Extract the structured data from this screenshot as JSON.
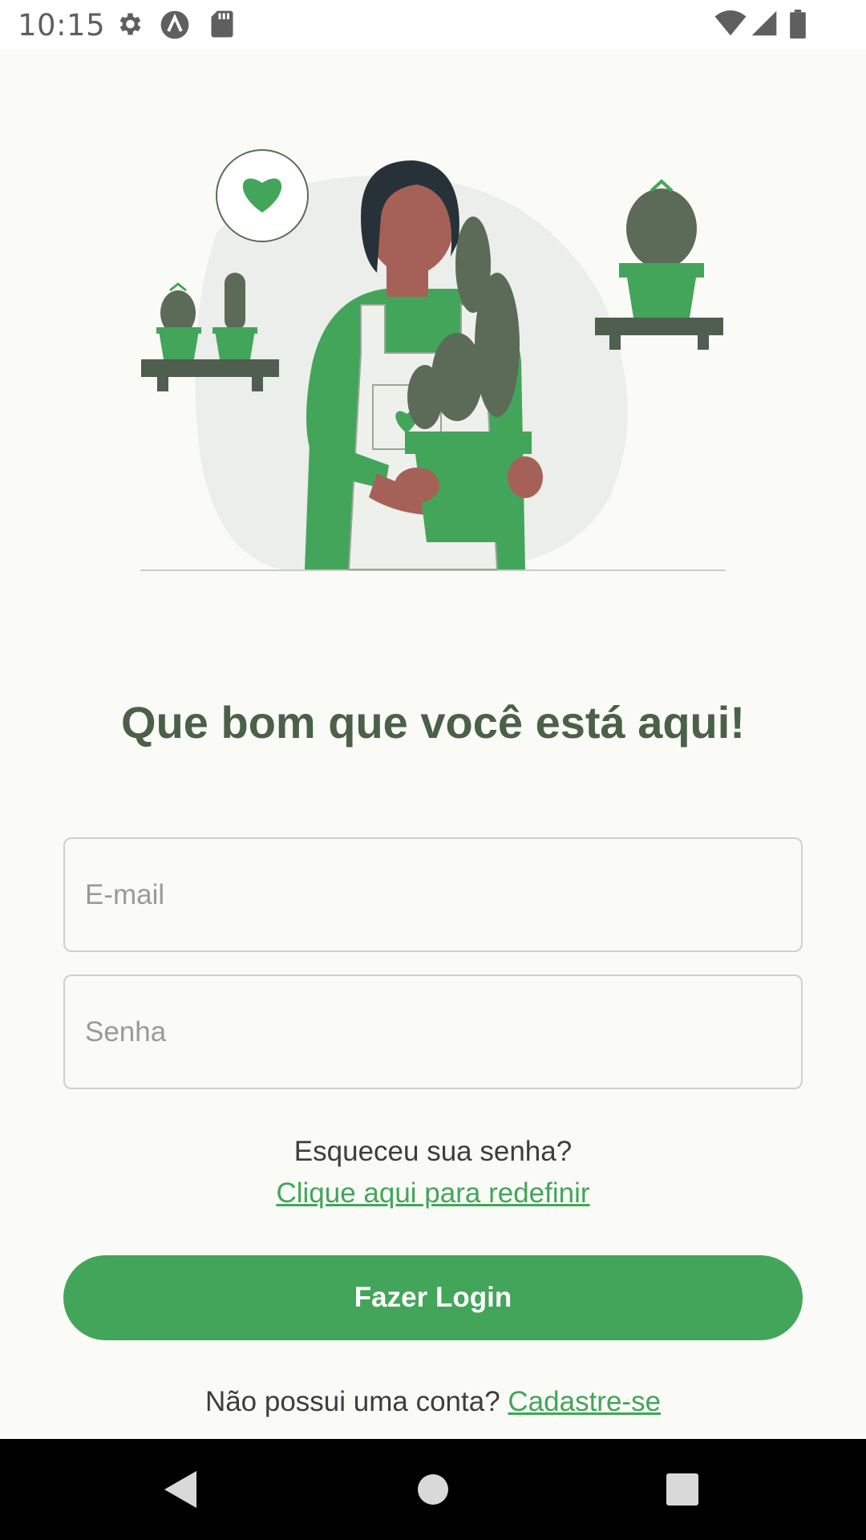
{
  "status_bar": {
    "time": "10:15",
    "left_icons": [
      "gear-icon",
      "app-logo-icon",
      "sd-card-icon"
    ],
    "right_icons": [
      "wifi-icon",
      "cell-signal-icon",
      "battery-icon"
    ]
  },
  "login": {
    "title": "Que bom que você está aqui!",
    "email_placeholder": "E-mail",
    "password_placeholder": "Senha",
    "forgot_question": "Esqueceu sua senha?",
    "forgot_link": "Clique aqui para redefinir",
    "login_button": "Fazer Login",
    "signup_question": "Não possui uma conta?",
    "signup_link": "Cadastre-se"
  },
  "colors": {
    "accent": "#43a55a",
    "title": "#4a6148",
    "background": "#fafbf7"
  },
  "nav_bar": {
    "icons": [
      "back-icon",
      "home-icon",
      "recents-icon"
    ]
  }
}
